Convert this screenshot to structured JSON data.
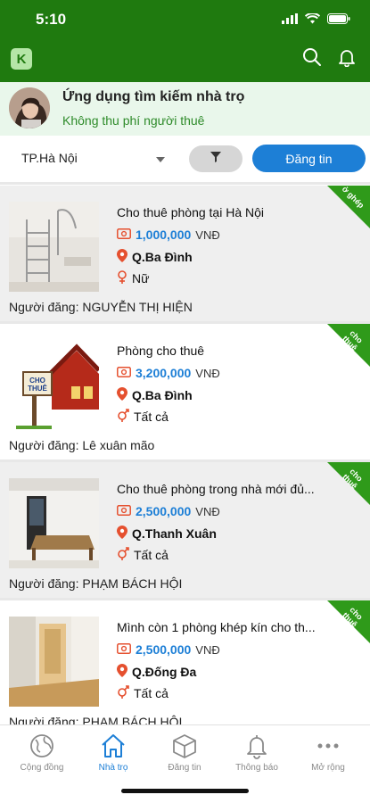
{
  "status_bar": {
    "time": "5:10"
  },
  "app_bar": {
    "logo_letter": "K"
  },
  "banner": {
    "title": "Ứng dụng tìm kiếm nhà trọ",
    "subtitle": "Không thu phí người thuê"
  },
  "filters": {
    "city": "TP.Hà Nội",
    "post_label": "Đăng tin"
  },
  "listings": [
    {
      "title": "Cho thuê phòng tại Hà Nội",
      "price": "1,000,000",
      "currency": "VNĐ",
      "district": "Q.Ba Đình",
      "gender": "Nữ",
      "poster_prefix": "Người đăng:",
      "poster": "NGUYỄN THỊ HIỆN",
      "ribbon": "ở ghép"
    },
    {
      "title": "Phòng cho thuê",
      "price": "3,200,000",
      "currency": "VNĐ",
      "district": "Q.Ba Đình",
      "gender": "Tất cả",
      "poster_prefix": "Người đăng:",
      "poster": "Lê xuân mão",
      "ribbon": "cho thuê",
      "sign_text": "CHO THUÊ"
    },
    {
      "title": "Cho thuê phòng trong nhà mới đủ...",
      "price": "2,500,000",
      "currency": "VNĐ",
      "district": "Q.Thanh Xuân",
      "gender": "Tất cả",
      "poster_prefix": "Người đăng:",
      "poster": "PHẠM BÁCH HỘI",
      "ribbon": "cho thuê"
    },
    {
      "title": "Mình còn 1 phòng khép kín cho th...",
      "price": "2,500,000",
      "currency": "VNĐ",
      "district": "Q.Đống Đa",
      "gender": "Tất cả",
      "poster_prefix": "Người đăng:",
      "poster": "PHẠM BÁCH HỘI",
      "ribbon": "cho thuê"
    }
  ],
  "bottom_nav": [
    {
      "label": "Cộng đồng",
      "icon": "globe-icon"
    },
    {
      "label": "Nhà trọ",
      "icon": "home-icon",
      "active": true
    },
    {
      "label": "Đăng tin",
      "icon": "box-icon"
    },
    {
      "label": "Thông báo",
      "icon": "bell-icon"
    },
    {
      "label": "Mở rộng",
      "icon": "more-icon"
    }
  ],
  "colors": {
    "brand_green": "#1f7a0f",
    "accent_blue": "#1d7fd6",
    "ribbon_green": "#2f9a1a",
    "icon_red": "#e5502f"
  }
}
